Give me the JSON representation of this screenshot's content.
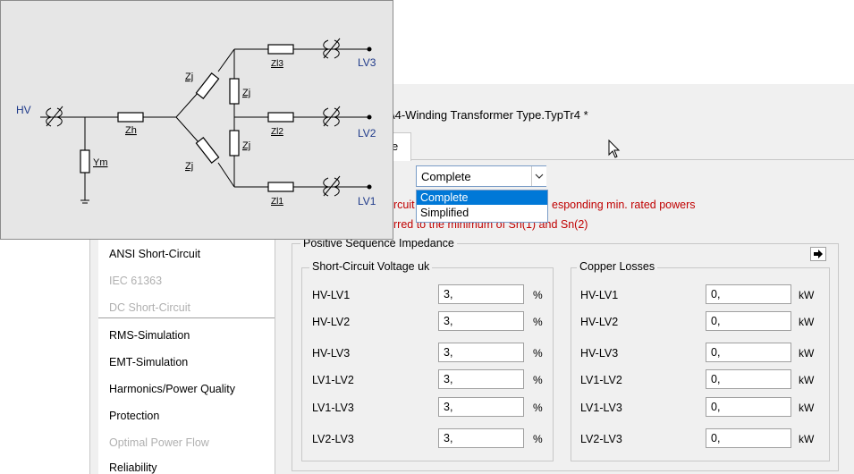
{
  "window": {
    "title": "\\4-Winding Transformer Type.TypTr4 *",
    "active_tab_label": "e"
  },
  "sidebar": {
    "items": [
      {
        "label": "ANSI Short-Circuit",
        "enabled": true
      },
      {
        "label": "IEC 61363",
        "enabled": false
      },
      {
        "label": "DC Short-Circuit",
        "enabled": false
      },
      {
        "label": "RMS-Simulation",
        "enabled": true
      },
      {
        "label": "EMT-Simulation",
        "enabled": true
      },
      {
        "label": "Harmonics/Power Quality",
        "enabled": true
      },
      {
        "label": "Protection",
        "enabled": true
      },
      {
        "label": "Optimal Power Flow",
        "enabled": false
      },
      {
        "label": "Reliability",
        "enabled": true
      }
    ]
  },
  "model_select": {
    "value": "Complete",
    "options": [
      "Complete",
      "Simplified"
    ],
    "highlighted": "Complete"
  },
  "notes": {
    "line1_left": "rcuit",
    "line1_right": "esponding min. rated powers",
    "line2": "rred to the minimum of Sn(1) and Sn(2)"
  },
  "positive_sequence": {
    "title": "Positive Sequence Impedance",
    "short_circuit": {
      "title": "Short-Circuit Voltage uk",
      "unit": "%",
      "rows": [
        {
          "label": "HV-LV1",
          "value": "3,"
        },
        {
          "label": "HV-LV2",
          "value": "3,"
        },
        {
          "label": "HV-LV3",
          "value": "3,"
        },
        {
          "label": "LV1-LV2",
          "value": "3,"
        },
        {
          "label": "LV1-LV3",
          "value": "3,"
        },
        {
          "label": "LV2-LV3",
          "value": "3,"
        }
      ]
    },
    "copper_losses": {
      "title": "Copper Losses",
      "unit": "kW",
      "rows": [
        {
          "label": "HV-LV1",
          "value": "0,"
        },
        {
          "label": "HV-LV2",
          "value": "0,"
        },
        {
          "label": "HV-LV3",
          "value": "0,"
        },
        {
          "label": "LV1-LV2",
          "value": "0,"
        },
        {
          "label": "LV1-LV3",
          "value": "0,"
        },
        {
          "label": "LV2-LV3",
          "value": "0,"
        }
      ]
    }
  },
  "diagram": {
    "bus_hv": "HV",
    "bus_lv1": "LV1",
    "bus_lv2": "LV2",
    "bus_lv3": "LV3",
    "z_h": "Zh",
    "z_m": "Ym",
    "z_j": "Zj",
    "z_l1": "Zl1",
    "z_l2": "Zl2",
    "z_l3": "Zl3",
    "colors": {
      "bus_label": "#1f3a8a",
      "line": "#000000",
      "background": "#e6e6e6"
    }
  }
}
